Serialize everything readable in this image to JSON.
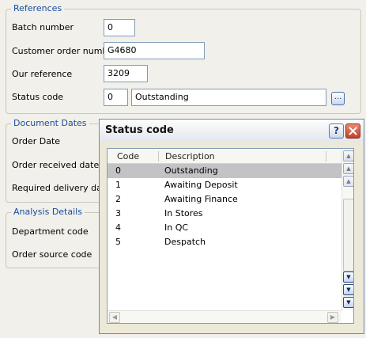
{
  "references": {
    "legend": "References",
    "batch_label": "Batch number",
    "batch_value": "0",
    "customer_order_label": "Customer order number",
    "customer_order_value": "G4680",
    "our_ref_label": "Our reference",
    "our_ref_value": "3209",
    "status_label": "Status code",
    "status_code_value": "0",
    "status_desc_value": "Outstanding",
    "lookup_button": "..."
  },
  "document_dates": {
    "legend": "Document Dates",
    "order_date_label": "Order Date",
    "order_received_label": "Order received date",
    "required_delivery_label": "Required delivery date"
  },
  "analysis": {
    "legend": "Analysis Details",
    "department_label": "Department code",
    "order_source_label": "Order source code"
  },
  "popup": {
    "title": "Status code",
    "help_label": "?",
    "columns": [
      "Code",
      "Description"
    ],
    "rows": [
      {
        "code": "0",
        "description": "Outstanding"
      },
      {
        "code": "1",
        "description": "Awaiting Deposit"
      },
      {
        "code": "2",
        "description": "Awaiting Finance"
      },
      {
        "code": "3",
        "description": "In Stores"
      },
      {
        "code": "4",
        "description": "In QC"
      },
      {
        "code": "5",
        "description": "Despatch"
      }
    ],
    "selected_row": 0
  },
  "colors": {
    "background": "#f1f0ea",
    "legend_text": "#1a4ea0",
    "selection": "#c3c3c6",
    "close_button": "#c24126"
  }
}
